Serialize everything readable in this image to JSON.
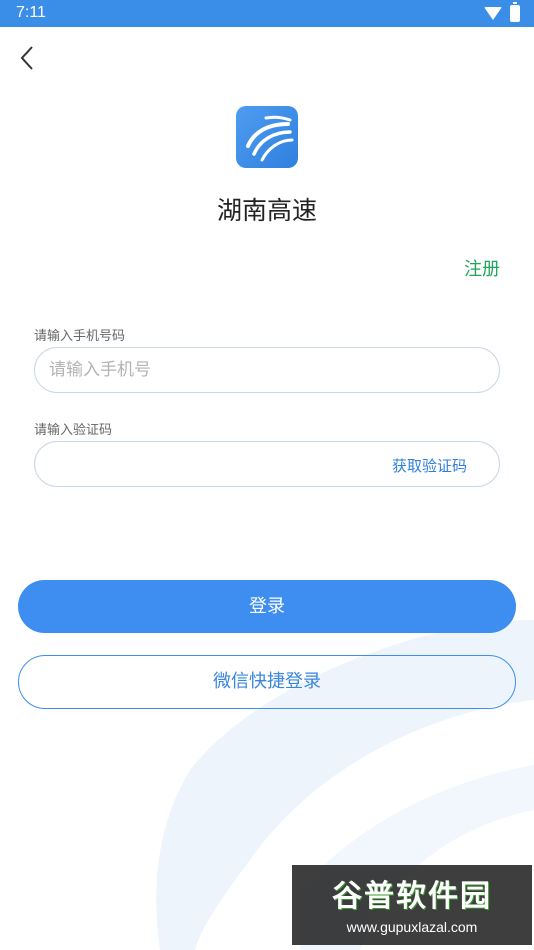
{
  "status_bar": {
    "time": "7:11"
  },
  "header": {
    "app_title": "湖南高速",
    "register_link": "注册"
  },
  "phone": {
    "label": "请输入手机号码",
    "placeholder": "请输入手机号",
    "value": ""
  },
  "code": {
    "label": "请输入验证码",
    "placeholder": "",
    "value": "",
    "get_code_label": "获取验证码"
  },
  "actions": {
    "login_label": "登录",
    "wechat_login_label": "微信快捷登录"
  },
  "watermark": {
    "title": "谷普软件园",
    "url": "www.gupuxlazal.com"
  },
  "colors": {
    "primary": "#3d8ef0",
    "register_green": "#1ea65a",
    "status_bar": "#3a8ee8"
  },
  "icons": {
    "back": "chevron-left-icon",
    "logo": "app-logo-icon"
  }
}
